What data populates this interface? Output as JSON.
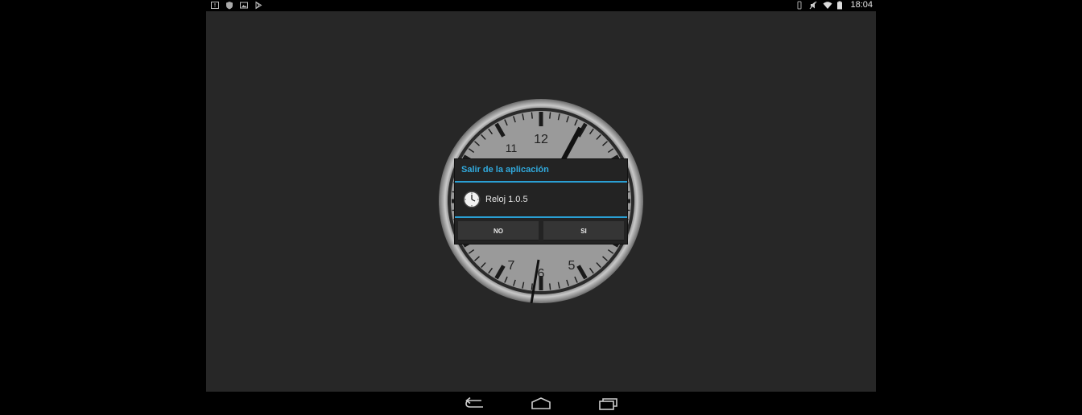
{
  "status_bar": {
    "left_icons": [
      "notification-icon",
      "shield-icon",
      "image-icon",
      "play-store-icon"
    ],
    "right_icons": [
      "vibrate-icon",
      "no-sound-icon",
      "wifi-icon",
      "battery-icon"
    ],
    "time": "18:04"
  },
  "clock_face": {
    "numbers": {
      "n12": "12",
      "n11": "11",
      "n7": "7",
      "n6": "6",
      "n5": "5"
    },
    "face_color": "#9a9a9a",
    "hand_color": "#111111"
  },
  "dialog": {
    "title": "Salir de la aplicación",
    "app_icon": "clock-icon",
    "message": "Reloj 1.0.5",
    "no_label": "NO",
    "yes_label": "SI",
    "accent": "#2a9fd3"
  },
  "nav_bar": {
    "buttons": [
      "back-icon",
      "home-icon",
      "recent-apps-icon"
    ]
  }
}
